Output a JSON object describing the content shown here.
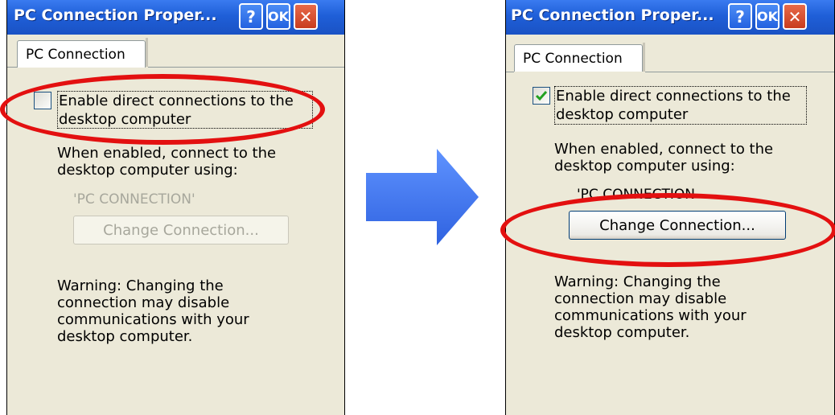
{
  "left_dialog": {
    "title": "PC Connection Proper...",
    "help_label": "?",
    "ok_label": "OK",
    "close_label": "✕",
    "tab_label": "PC Connection",
    "checkbox_label_line1": "Enable direct connections to the",
    "checkbox_label_line2": "desktop computer",
    "checkbox_checked": false,
    "when_enabled_line1": "When enabled, connect to the",
    "when_enabled_line2": "desktop computer using:",
    "connection_name": "'PC CONNECTION'",
    "change_button_label": "Change Connection...",
    "change_button_enabled": false,
    "warning_line1": "Warning: Changing the",
    "warning_line2": "connection may disable",
    "warning_line3": "communications with your",
    "warning_line4": "desktop computer."
  },
  "right_dialog": {
    "title": "PC Connection Proper...",
    "help_label": "?",
    "ok_label": "OK",
    "close_label": "✕",
    "tab_label": "PC Connection",
    "checkbox_label_line1": "Enable direct connections to the",
    "checkbox_label_line2": "desktop computer",
    "checkbox_checked": true,
    "when_enabled_line1": "When enabled, connect to the",
    "when_enabled_line2": "desktop computer using:",
    "connection_name": "'PC CONNECTION",
    "change_button_label": "Change Connection...",
    "change_button_enabled": true,
    "warning_line1": "Warning: Changing the",
    "warning_line2": "connection may disable",
    "warning_line3": "communications with your",
    "warning_line4": "desktop computer."
  },
  "colors": {
    "title_bar": "#1f5fd8",
    "window_bg": "#ece9d8",
    "highlight": "#e31010",
    "arrow": "#3a6ff0"
  },
  "icons": {
    "arrow": "right-arrow-icon",
    "check": "check-icon"
  }
}
